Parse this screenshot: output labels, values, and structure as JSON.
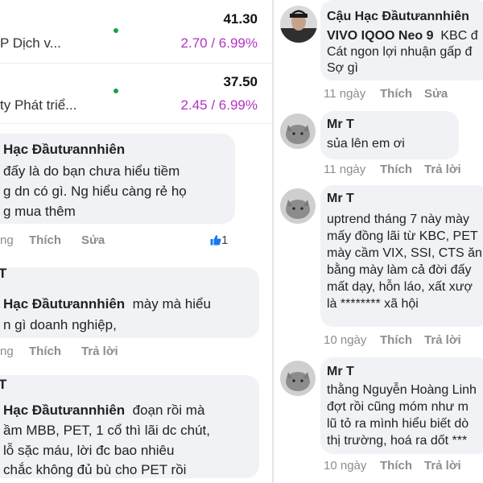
{
  "stocks": [
    {
      "price": "41.30",
      "name": "P Dịch v...",
      "change": "2.70 / 6.99%"
    },
    {
      "price": "37.50",
      "name": "ty Phát triể...",
      "change": "2.45 / 6.99%"
    }
  ],
  "left_comments": [
    {
      "author": "Hạc Đầutưannhiên",
      "lines": [
        "đấy là do bạn chưa hiểu tiềm",
        "g dn có gì. Ng hiểu càng rẻ họ",
        "g mua thêm"
      ],
      "time": "ng",
      "like": "Thích",
      "action2": "Sửa",
      "reaction_count": "1"
    },
    {
      "author_prefix": "T",
      "author": "Hạc Đầutưannhiên",
      "inline_text": "mày mà hiểu",
      "lines": [
        "n gì doanh nghiệp,"
      ],
      "time": "ng",
      "like": "Thích",
      "action2": "Trả lời"
    },
    {
      "author_prefix": "T",
      "author": "Hạc Đầutưannhiên",
      "inline_text": "đoạn rồi mà",
      "lines": [
        "ầm MBB, PET, 1 cổ thì lãi dc chút,",
        "lỗ sặc máu, lời đc bao nhiêu",
        "chắc không đủ bù cho PET rồi"
      ]
    }
  ],
  "right_comments": [
    {
      "author": "Cậu Hạc Đầutưannhiên",
      "first_bold": "VIVO IQOO Neo 9",
      "first_rest": "KBC đ",
      "lines": [
        "Cát ngon lợi nhuận gấp đ",
        "Sợ gì"
      ],
      "time": "11 ngày",
      "like": "Thích",
      "action2": "Sửa"
    },
    {
      "author": "Mr T",
      "lines": [
        "sủa lên em ơi"
      ],
      "time": "11 ngày",
      "like": "Thích",
      "action2": "Trả lời"
    },
    {
      "author": "Mr T",
      "lines": [
        "uptrend tháng 7 này mày",
        "mấy đồng lãi từ KBC, PET",
        "mày cầm VIX, SSI, CTS ăn",
        "bằng mày làm cả đời đấy",
        "mất dạy, hỗn láo, xất xượ",
        "là ******** xã hội"
      ],
      "time": "10 ngày",
      "like": "Thích",
      "action2": "Trả lời"
    },
    {
      "author": "Mr T",
      "lines": [
        "thằng Nguyễn Hoàng Linh",
        "đợt rồi cũng móm như m",
        "lũ tỏ ra mình hiểu biết dò",
        "thị trường, hoá ra  dốt ***"
      ],
      "time": "10 ngày",
      "like": "Thích",
      "action2": "Trả lời"
    }
  ]
}
